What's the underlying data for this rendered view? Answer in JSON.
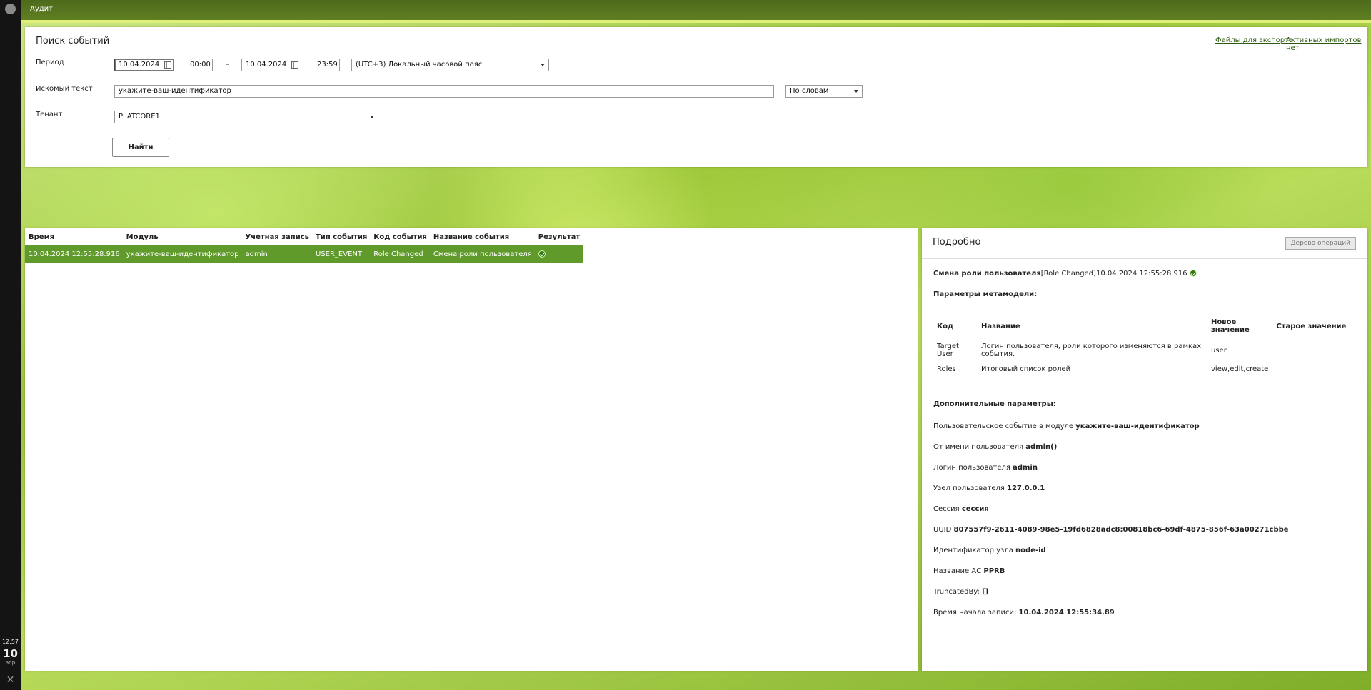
{
  "app": {
    "title": "Аудит"
  },
  "rail": {
    "time": "12:57",
    "day": "10",
    "month": "апр",
    "close_glyph": "✕"
  },
  "search": {
    "title": "Поиск событий",
    "links": {
      "export_files": "Файлы для экспорта",
      "active_imports": "Активных импортов нет"
    },
    "period_label": "Период",
    "date_from": "10.04.2024",
    "time_from": "00:00",
    "dash": "–",
    "date_to": "10.04.2024",
    "time_to": "23:59",
    "timezone": "(UTC+3) Локальный часовой пояс",
    "text_label": "Искомый текст",
    "text_value": "укажите-ваш-идентификатор",
    "match_mode": "По словам",
    "tenant_label": "Тенант",
    "tenant_value": "PLATCORE1",
    "find_button": "Найти"
  },
  "results": {
    "columns": [
      "Время",
      "Модуль",
      "Учетная запись",
      "Тип события",
      "Код события",
      "Название события",
      "Результат"
    ],
    "rows": [
      {
        "time": "10.04.2024 12:55:28.916",
        "module": "укажите-ваш-идентификатор",
        "account": "admin",
        "event_type": "USER_EVENT",
        "event_code": "Role Changed",
        "event_name": "Смена роли пользователя",
        "result_icon": "success-check-icon"
      }
    ]
  },
  "detail": {
    "title": "Подробно",
    "tree_button": "Дерево операций",
    "event_name": "Смена роли пользователя",
    "event_code_bracket": "[Role Changed]",
    "event_time": "10.04.2024 12:55:28.916",
    "metamodel_head": "Параметры метамодели:",
    "meta_columns": [
      "Код",
      "Название",
      "Новое значение",
      "Старое значение"
    ],
    "meta_rows": [
      {
        "code": "Target User",
        "name": "Логин пользователя, роли которого изменяются в рамках события.",
        "new": "user",
        "old": ""
      },
      {
        "code": "Roles",
        "name": "Итоговый список ролей",
        "new": "view,edit,create",
        "old": ""
      }
    ],
    "extra_head": "Дополнительные параметры:",
    "params": [
      {
        "label": "Пользовательское событие в модуле",
        "value": "укажите-ваш-идентификатор"
      },
      {
        "label": "От имени пользователя",
        "value": "admin()"
      },
      {
        "label": "Логин пользователя",
        "value": "admin"
      },
      {
        "label": "Узел пользователя",
        "value": "127.0.0.1"
      },
      {
        "label": "Сессия",
        "value": "сессия"
      },
      {
        "label": "UUID",
        "value": "807557f9-2611-4089-98e5-19fd6828adc8:00818bc6-69df-4875-856f-63a00271cbbe"
      },
      {
        "label": "Идентификатор узла",
        "value": "node-id"
      },
      {
        "label": "Название АС",
        "value": "PPRB"
      },
      {
        "label": "TruncatedBy:",
        "value": "[]"
      },
      {
        "label": "Время начала записи:",
        "value": "10.04.2024 12:55:34.89"
      }
    ]
  }
}
